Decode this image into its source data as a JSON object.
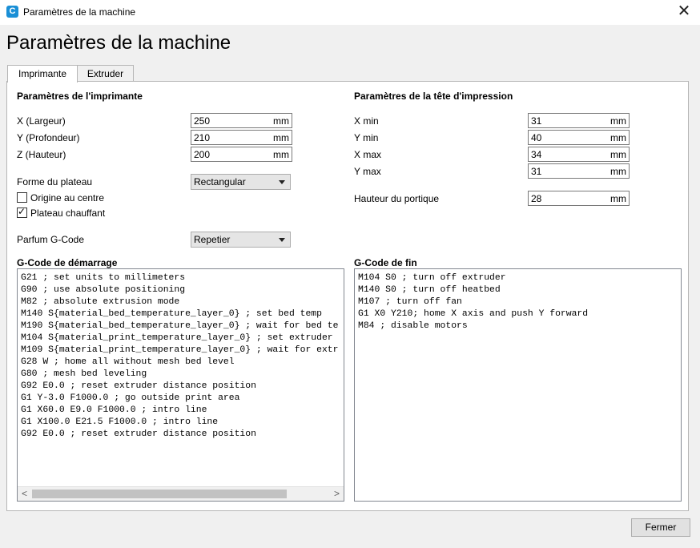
{
  "window": {
    "title": "Paramètres de la machine",
    "close_glyph": "✕",
    "app_icon_letter": "C"
  },
  "page": {
    "title": "Paramètres de la machine"
  },
  "tabs": [
    {
      "label": "Imprimante"
    },
    {
      "label": "Extruder"
    }
  ],
  "printer": {
    "section_title": "Paramètres de l'imprimante",
    "width": {
      "label": "X (Largeur)",
      "value": "250",
      "unit": "mm"
    },
    "depth": {
      "label": "Y (Profondeur)",
      "value": "210",
      "unit": "mm"
    },
    "height": {
      "label": "Z (Hauteur)",
      "value": "200",
      "unit": "mm"
    },
    "bed_shape": {
      "label": "Forme du plateau",
      "value": "Rectangular"
    },
    "origin_center": {
      "label": "Origine au centre",
      "checked": false
    },
    "heated_bed": {
      "label": "Plateau chauffant",
      "checked": true,
      "mark": "✓"
    },
    "gcode_flavor": {
      "label": "Parfum G-Code",
      "value": "Repetier"
    }
  },
  "printhead": {
    "section_title": "Paramètres de la tête d'impression",
    "x_min": {
      "label": "X min",
      "value": "31",
      "unit": "mm"
    },
    "y_min": {
      "label": "Y min",
      "value": "40",
      "unit": "mm"
    },
    "x_max": {
      "label": "X max",
      "value": "34",
      "unit": "mm"
    },
    "y_max": {
      "label": "Y max",
      "value": "31",
      "unit": "mm"
    },
    "gantry_height": {
      "label": "Hauteur du portique",
      "value": "28",
      "unit": "mm"
    }
  },
  "start_gcode": {
    "title": "G-Code de démarrage",
    "text": "G21 ; set units to millimeters\nG90 ; use absolute positioning\nM82 ; absolute extrusion mode\nM140 S{material_bed_temperature_layer_0} ; set bed temp\nM190 S{material_bed_temperature_layer_0} ; wait for bed te\nM104 S{material_print_temperature_layer_0} ; set extruder\nM109 S{material_print_temperature_layer_0} ; wait for extr\nG28 W ; home all without mesh bed level\nG80 ; mesh bed leveling\nG92 E0.0 ; reset extruder distance position\nG1 Y-3.0 F1000.0 ; go outside print area\nG1 X60.0 E9.0 F1000.0 ; intro line\nG1 X100.0 E21.5 F1000.0 ; intro line\nG92 E0.0 ; reset extruder distance position",
    "scroll_left": "<",
    "scroll_right": ">"
  },
  "end_gcode": {
    "title": "G-Code de fin",
    "text": "M104 S0 ; turn off extruder\nM140 S0 ; turn off heatbed\nM107 ; turn off fan\nG1 X0 Y210; home X axis and push Y forward\nM84 ; disable motors"
  },
  "footer": {
    "close_label": "Fermer"
  }
}
